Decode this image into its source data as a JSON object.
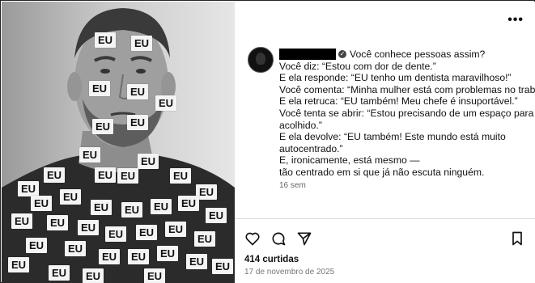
{
  "post": {
    "more_icon": "more-horizontal-icon",
    "caption_title": "Você conhece pessoas assim?",
    "caption_lines": [
      "Você diz: “Estou com dor de dente.”",
      "E ela responde: “EU tenho um dentista maravilhoso!”",
      "Você comenta: “Minha mulher está com problemas no trabalho.”",
      "E ela retruca: “EU também! Meu chefe é insuportável.”",
      "Você tenta se abrir: “Estou precisando de um espaço para ser",
      "acolhido.”",
      "E ela devolve: “EU também! Este mundo está muito",
      "autocentrado.”",
      "E, ironicamente, está mesmo —",
      "tão centrado em si que já não escuta ninguém."
    ],
    "time_ago": "16 sem",
    "likes": "414 curtidas",
    "date": "17 de novembro de 2025"
  },
  "photo": {
    "sticker_text": "EU"
  }
}
